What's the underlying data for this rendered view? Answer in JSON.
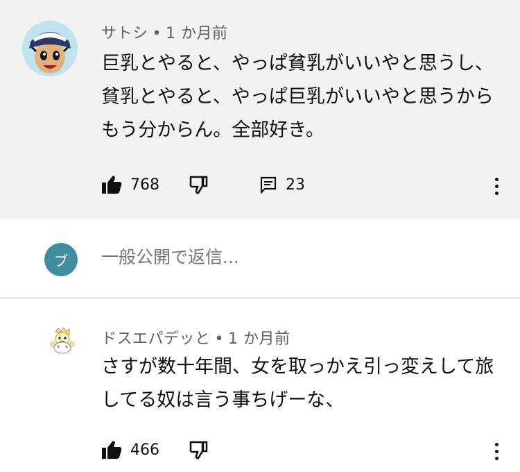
{
  "comments": [
    {
      "author": "サトシ",
      "separator": "•",
      "time": "1 か月前",
      "text": "巨乳とやると、やっぱ貧乳がいいやと思うし、貧乳とやると、やっぱ巨乳がいいやと思うからもう分からん。全部好き。",
      "likes": "768",
      "replies": "23"
    },
    {
      "author": "ドスエパデッと",
      "separator": "•",
      "time": "1 か月前",
      "text": "さすが数十年間、女を取っかえ引っ変えして旅してる奴は言う事ちげーな、",
      "likes": "466"
    }
  ],
  "reply_box": {
    "avatar_letter": "ブ",
    "placeholder": "一般公開で返信..."
  },
  "colors": {
    "highlight_bg": "#f2f2f2",
    "reply_avatar": "#3f8fa0",
    "meta_text": "#606060"
  }
}
